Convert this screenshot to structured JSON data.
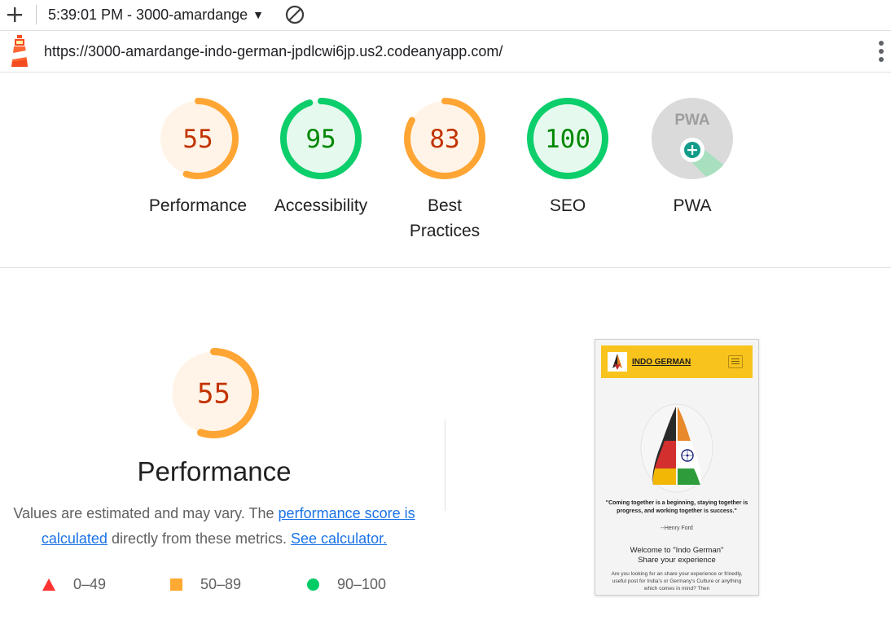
{
  "toolbar": {
    "report_label": "5:39:01 PM - 3000-amardange"
  },
  "urlbar": {
    "url": "https://3000-amardange-indo-german-jpdlcwi6jp.us2.codeanyapp.com/"
  },
  "categories": [
    {
      "label": "Performance",
      "score": 55,
      "rating": "average"
    },
    {
      "label": "Accessibility",
      "score": 95,
      "rating": "pass"
    },
    {
      "label": "Best Practices",
      "score": 83,
      "rating": "average"
    },
    {
      "label": "SEO",
      "score": 100,
      "rating": "pass"
    },
    {
      "label": "PWA",
      "badge_text": "PWA"
    }
  ],
  "performance": {
    "score": 55,
    "title": "Performance",
    "desc_prefix": "Values are estimated and may vary. The ",
    "link_score": "performance score is calculated",
    "desc_middle": " directly from these metrics. ",
    "link_calc": "See calculator."
  },
  "legend": [
    {
      "range": "0–49",
      "color": "#ff3333"
    },
    {
      "range": "50–89",
      "color": "#ffaa33"
    },
    {
      "range": "90–100",
      "color": "#00cc66"
    }
  ],
  "colors": {
    "average_stroke": "#ffa534",
    "average_fill": "#fff4e7",
    "average_text": "#c33300",
    "pass_stroke": "#0cce6b",
    "pass_fill": "#e6f9ee",
    "pass_text": "#008800",
    "link": "#1a73e8"
  },
  "screenshot": {
    "brand": "INDO GERMAN",
    "quote": "\"Coming together is a beginning, staying together is progress, and working together is success.\"",
    "author": "--Henry Ford",
    "welcome_1": "Welcome to \"Indo German\"",
    "welcome_2": "Share your experience",
    "body": "Are you looking for an share your experience or frinedly, useful post for India's or Germany's Culture or anything which comes in mind? Then"
  }
}
